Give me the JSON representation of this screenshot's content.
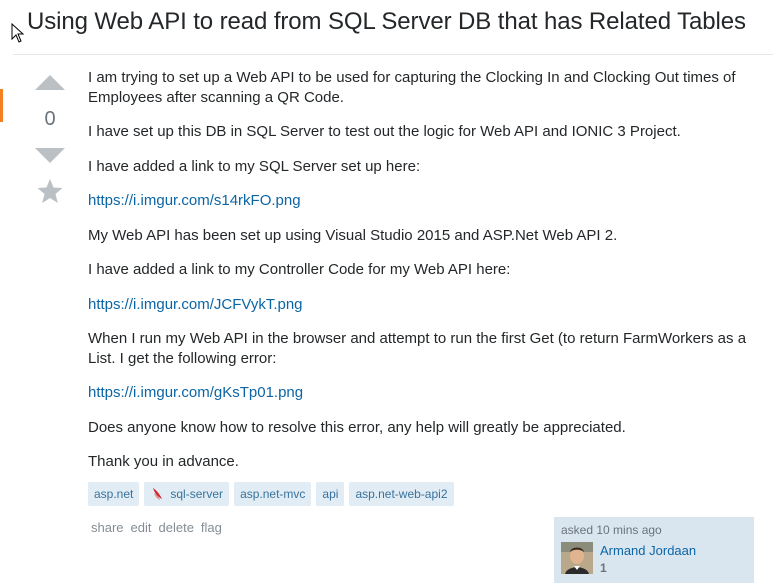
{
  "question": {
    "title": "Using Web API to read from SQL Server DB that has Related Tables",
    "votes": "0",
    "paragraphs": [
      "I am trying to set up a Web API to be used for capturing the Clocking In and Clocking Out times of Employees after scanning a QR Code.",
      "I have set up this DB in SQL Server to test out the logic for Web API and IONIC 3 Project.",
      "I have added a link to my SQL Server set up here:",
      "https://i.imgur.com/s14rkFO.png",
      "My Web API has been set up using Visual Studio 2015 and ASP.Net Web API 2.",
      "I have added a link to my Controller Code for my Web API here:",
      "https://i.imgur.com/JCFVykT.png",
      "When I run my Web API in the browser and attempt to run the first Get (to return FarmWorkers as a List. I get the following error:",
      "https://i.imgur.com/gKsTp01.png",
      "Does anyone know how to resolve this error, any help will greatly be appreciated.",
      "Thank you in advance."
    ],
    "tags": [
      "asp.net",
      "sql-server",
      "asp.net-mvc",
      "api",
      "asp.net-web-api2"
    ],
    "menu": [
      "share",
      "edit",
      "delete",
      "flag"
    ],
    "asked": "asked 10 mins ago",
    "user_name": "Armand Jordaan",
    "reputation": "1"
  },
  "icons": {
    "vote_up": "arrow-up-icon",
    "vote_down": "arrow-down-icon",
    "favorite": "star-icon",
    "tag_sql": "sql-server-icon",
    "cursor": "mouse-cursor-icon"
  },
  "colors": {
    "accent": "#f48024",
    "link": "#0c65a5",
    "tag_bg": "#e1ecf4",
    "tag_text": "#39739d",
    "user_card_bg": "#d9e6f0"
  }
}
